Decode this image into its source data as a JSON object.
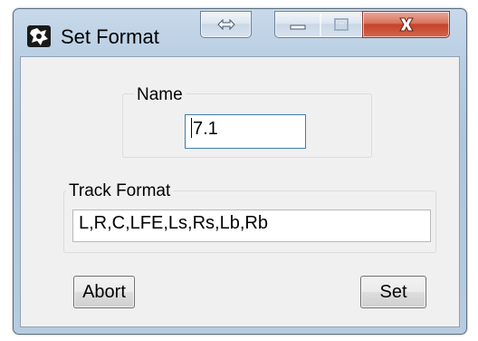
{
  "window": {
    "title": "Set Format",
    "icon": "app-icon",
    "controls": {
      "resize_icon": "double-arrow-icon",
      "minimize_icon": "minimize-icon",
      "maximize_icon": "maximize-icon",
      "close_icon": "close-icon"
    }
  },
  "form": {
    "name_label": "Name",
    "name_value": "7.1",
    "track_format_label": "Track Format",
    "track_format_value": "L,R,C,LFE,Ls,Rs,Lb,Rb"
  },
  "buttons": {
    "abort_label": "Abort",
    "set_label": "Set"
  },
  "colors": {
    "frame": "#b8cde2",
    "client_background": "#f0f0f0",
    "close_button": "#c6422a",
    "focus_border": "#3c7fb1"
  }
}
